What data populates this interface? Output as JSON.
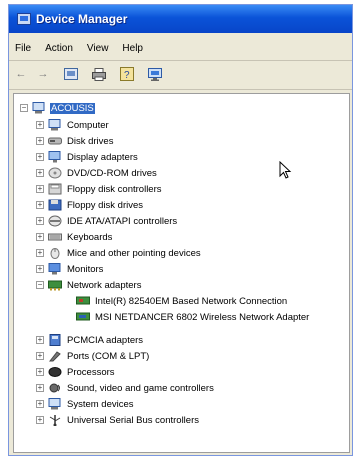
{
  "window": {
    "title": "Device Manager"
  },
  "menu": {
    "file": "File",
    "action": "Action",
    "view": "View",
    "help": "Help"
  },
  "toolbar": {
    "icons": [
      "back-arrow-icon",
      "forward-arrow-icon",
      "properties-icon",
      "print-icon",
      "help-icon",
      "update-driver-icon"
    ]
  },
  "tree": {
    "root": {
      "label": "ACOUSIS"
    },
    "categories": [
      "Computer",
      "Disk drives",
      "Display adapters",
      "DVD/CD-ROM drives",
      "Floppy disk controllers",
      "Floppy disk drives",
      "IDE ATA/ATAPI controllers",
      "Keyboards",
      "Mice and other pointing devices",
      "Monitors",
      "Network adapters",
      "PCMCIA adapters",
      "Ports (COM & LPT)",
      "Processors",
      "Sound, video and game controllers",
      "System devices",
      "Universal Serial Bus controllers"
    ],
    "network_children": [
      "Intel(R) 82540EM Based Network Connection",
      "MSI NETDANCER 6802 Wireless Network Adapter"
    ]
  },
  "colors": {
    "title_bar": "#0a53d8",
    "selection": "#316ac5",
    "window_face": "#ece9d8"
  }
}
